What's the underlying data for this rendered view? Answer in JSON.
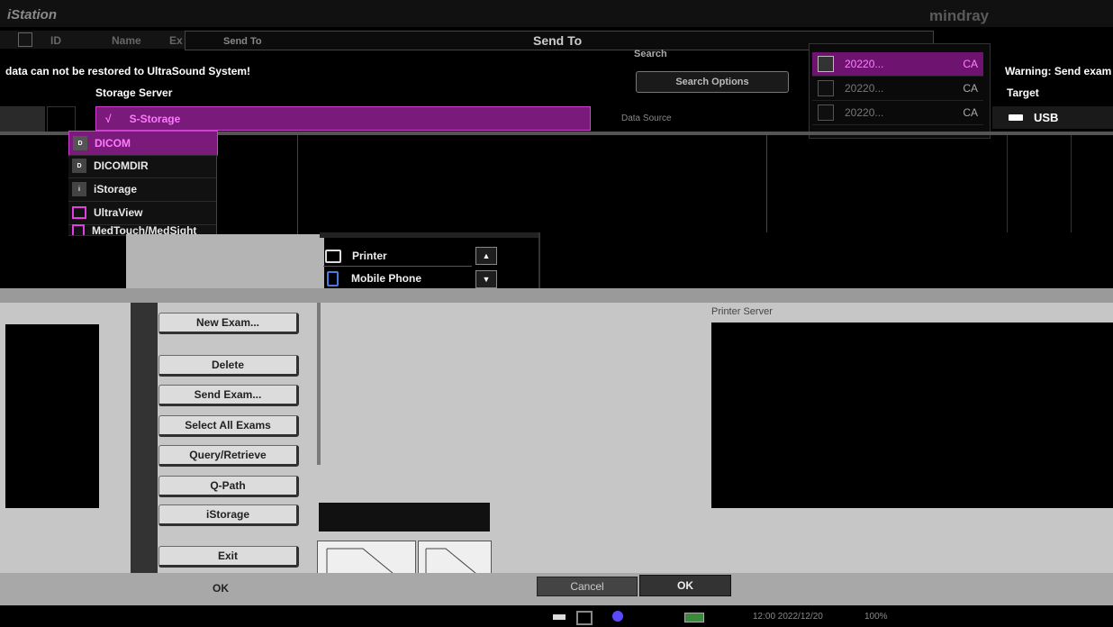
{
  "app": {
    "title": "iStation",
    "brand": "mindray"
  },
  "header": {
    "col_id": "ID",
    "col_name": "Name",
    "col_ex": "Ex",
    "send_to_bg": "Send To",
    "send_to_title": "Send To"
  },
  "search": {
    "label": "Search",
    "options_button": "Search Options",
    "source_label": "Data Source"
  },
  "warning": {
    "left": "data can not be restored to UltraSound System!",
    "right": "Warning: Send exam"
  },
  "storage": {
    "heading": "Storage Server",
    "selected": {
      "check": "√",
      "label": "S-Storage"
    },
    "items": [
      {
        "label": "DICOM",
        "icon": "dicom-icon",
        "selected": true
      },
      {
        "label": "DICOMDIR",
        "icon": "dicomdir-icon",
        "selected": false
      },
      {
        "label": "iStorage",
        "icon": "istorage-icon",
        "selected": false
      },
      {
        "label": "UltraView",
        "icon": "ultraview-icon",
        "selected": false
      },
      {
        "label": "MedTouch/MedSight",
        "icon": "medtouch-icon",
        "selected": false
      }
    ]
  },
  "target": {
    "heading": "Target",
    "usb": "USB"
  },
  "exam_list": {
    "rows": [
      {
        "date": "20220...",
        "code": "CA",
        "selected": true
      },
      {
        "date": "20220...",
        "code": "CA",
        "selected": false
      },
      {
        "date": "20220...",
        "code": "CA",
        "selected": false
      }
    ]
  },
  "devices": [
    {
      "label": "Printer",
      "icon": "printer-icon"
    },
    {
      "label": "Mobile Phone",
      "icon": "mobile-phone-icon"
    }
  ],
  "actions": {
    "new_exam": "New Exam...",
    "delete": "Delete",
    "send_exam": "Send Exam...",
    "select_all": "Select All Exams",
    "query_retrieve": "Query/Retrieve",
    "q_path": "Q-Path",
    "iStorage": "iStorage",
    "exit": "Exit"
  },
  "printer_server": {
    "label": "Printer Server"
  },
  "footer": {
    "ok_left": "OK",
    "cancel": "Cancel",
    "ok_right": "OK"
  },
  "status": {
    "datetime": "12:00 2022/12/20",
    "zoom": "100%"
  },
  "colors": {
    "accent": "#ff3cff",
    "selected_bg": "#7a1a7a",
    "panel_gray": "#c6c6c6",
    "bg": "#000000"
  }
}
